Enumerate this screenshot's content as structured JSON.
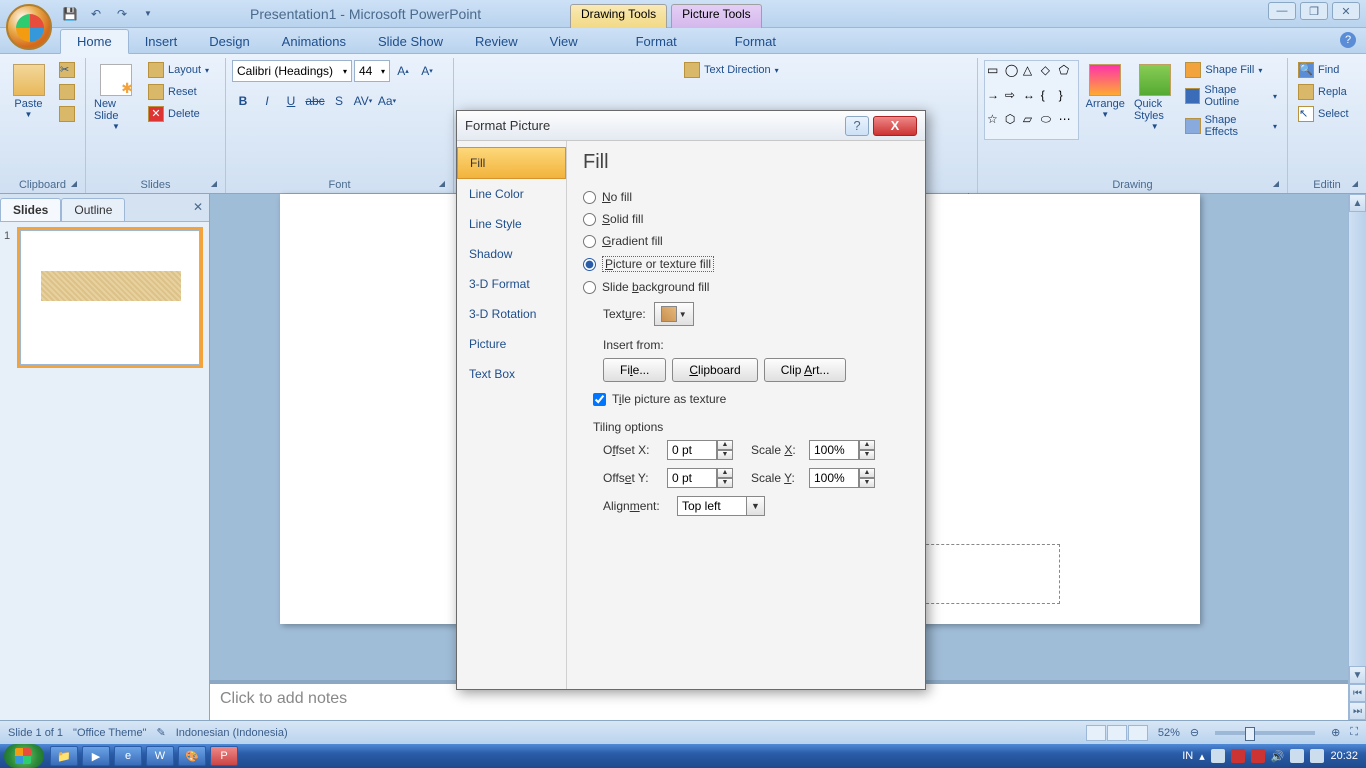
{
  "title": "Presentation1 - Microsoft PowerPoint",
  "toolTabs": {
    "drawing": "Drawing Tools",
    "picture": "Picture Tools"
  },
  "ribbonTabs": [
    "Home",
    "Insert",
    "Design",
    "Animations",
    "Slide Show",
    "Review",
    "View",
    "Format",
    "Format"
  ],
  "clipboard": {
    "paste": "Paste",
    "label": "Clipboard"
  },
  "slides": {
    "new": "New Slide",
    "layout": "Layout",
    "reset": "Reset",
    "delete": "Delete",
    "label": "Slides"
  },
  "font": {
    "name": "Calibri (Headings)",
    "size": "44",
    "label": "Font"
  },
  "paragraph": {
    "textDirection": "Text Direction"
  },
  "drawing": {
    "arrange": "Arrange",
    "quick": "Quick Styles",
    "fill": "Shape Fill",
    "outline": "Shape Outline",
    "effects": "Shape Effects",
    "label": "Drawing"
  },
  "editing": {
    "find": "Find",
    "replace": "Repla",
    "select": "Select",
    "label": "Editin"
  },
  "panel": {
    "slides": "Slides",
    "outline": "Outline"
  },
  "notes": "Click to add notes",
  "status": {
    "slide": "Slide 1 of 1",
    "theme": "\"Office Theme\"",
    "lang": "Indonesian (Indonesia)",
    "zoom": "52%"
  },
  "dialog": {
    "title": "Format Picture",
    "nav": [
      "Fill",
      "Line Color",
      "Line Style",
      "Shadow",
      "3-D Format",
      "3-D Rotation",
      "Picture",
      "Text Box"
    ],
    "heading": "Fill",
    "radios": {
      "nofill": "No fill",
      "solid": "Solid fill",
      "gradient": "Gradient fill",
      "picture": "Picture or texture fill",
      "slidebg": "Slide background fill"
    },
    "texture": "Texture:",
    "insertFrom": "Insert from:",
    "btns": {
      "file": "File...",
      "clipboard": "Clipboard",
      "clipart": "Clip Art..."
    },
    "tile": "Tile picture as texture",
    "tiling": "Tiling options",
    "offsetX": {
      "label": "Offset X:",
      "value": "0 pt"
    },
    "offsetY": {
      "label": "Offset Y:",
      "value": "0 pt"
    },
    "scaleX": {
      "label": "Scale X:",
      "value": "100%"
    },
    "scaleY": {
      "label": "Scale Y:",
      "value": "100%"
    },
    "alignment": {
      "label": "Alignment:",
      "value": "Top left"
    }
  },
  "taskbar": {
    "lang": "IN",
    "time": "20:32"
  }
}
